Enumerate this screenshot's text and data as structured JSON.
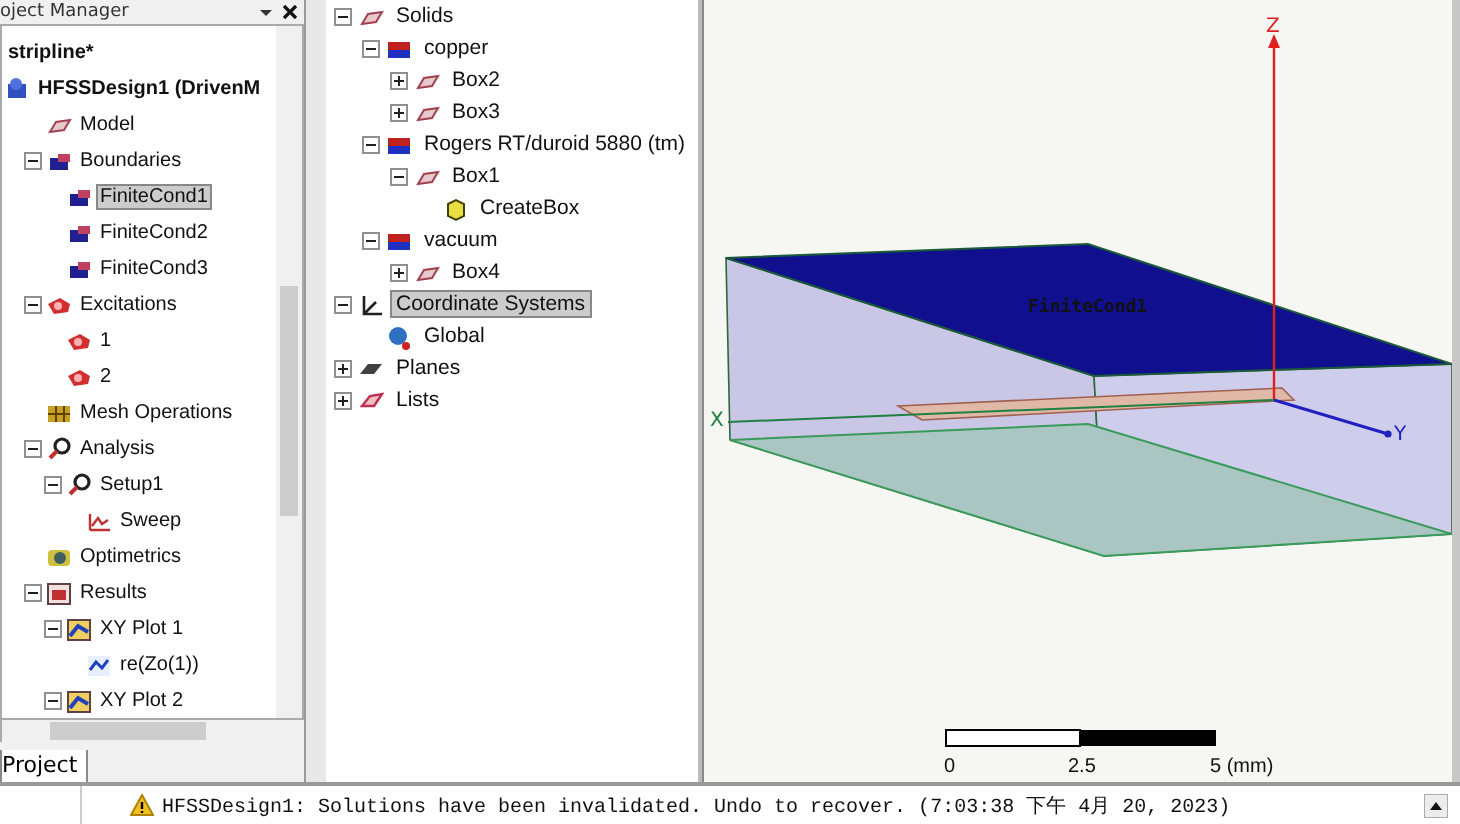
{
  "project_manager": {
    "title": "oject Manager",
    "tab": "Project",
    "tree": [
      {
        "label": "stripline*",
        "kind": "project",
        "selected": false
      },
      {
        "label": "HFSSDesign1 (DrivenM",
        "kind": "design",
        "selected": false,
        "children": [
          {
            "label": "Model",
            "kind": "part",
            "selected": false
          },
          {
            "label": "Boundaries",
            "kind": "boundary",
            "selected": false,
            "expanded": true,
            "children": [
              {
                "label": "FiniteCond1",
                "kind": "boundary",
                "selected": true
              },
              {
                "label": "FiniteCond2",
                "kind": "boundary",
                "selected": false
              },
              {
                "label": "FiniteCond3",
                "kind": "boundary",
                "selected": false
              }
            ]
          },
          {
            "label": "Excitations",
            "kind": "excitation",
            "selected": false,
            "expanded": true,
            "children": [
              {
                "label": "1",
                "kind": "excitation",
                "selected": false
              },
              {
                "label": "2",
                "kind": "excitation",
                "selected": false
              }
            ]
          },
          {
            "label": "Mesh Operations",
            "kind": "mesh",
            "selected": false
          },
          {
            "label": "Analysis",
            "kind": "analysis",
            "selected": false,
            "expanded": true,
            "children": [
              {
                "label": "Setup1",
                "kind": "analysis",
                "selected": false,
                "expanded": true,
                "children": [
                  {
                    "label": "Sweep",
                    "kind": "sweep",
                    "selected": false
                  }
                ]
              }
            ]
          },
          {
            "label": "Optimetrics",
            "kind": "optimetrics",
            "selected": false
          },
          {
            "label": "Results",
            "kind": "results",
            "selected": false,
            "expanded": true,
            "children": [
              {
                "label": "XY Plot 1",
                "kind": "plot",
                "selected": false,
                "expanded": true,
                "children": [
                  {
                    "label": "re(Zo(1))",
                    "kind": "trace",
                    "selected": false
                  }
                ]
              },
              {
                "label": "XY Plot 2",
                "kind": "plot",
                "selected": false,
                "expanded": true
              }
            ]
          }
        ]
      }
    ]
  },
  "model_tree": [
    {
      "label": "Solids",
      "kind": "part",
      "selected": false,
      "expanded": true,
      "children": [
        {
          "label": "copper",
          "kind": "material",
          "selected": false,
          "expanded": true,
          "children": [
            {
              "label": "Box2",
              "kind": "part",
              "selected": false,
              "expanded": false
            },
            {
              "label": "Box3",
              "kind": "part",
              "selected": false,
              "expanded": false
            }
          ]
        },
        {
          "label": "Rogers RT/duroid 5880 (tm)",
          "kind": "material",
          "selected": false,
          "expanded": true,
          "children": [
            {
              "label": "Box1",
              "kind": "part",
              "selected": false,
              "expanded": true,
              "children": [
                {
                  "label": "CreateBox",
                  "kind": "operation",
                  "selected": false
                }
              ]
            }
          ]
        },
        {
          "label": "vacuum",
          "kind": "material",
          "selected": false,
          "expanded": true,
          "children": [
            {
              "label": "Box4",
              "kind": "part",
              "selected": false,
              "expanded": false
            }
          ]
        }
      ]
    },
    {
      "label": "Coordinate Systems",
      "kind": "coords",
      "selected": true,
      "expanded": true,
      "children": [
        {
          "label": "Global",
          "kind": "origin",
          "selected": false
        }
      ]
    },
    {
      "label": "Planes",
      "kind": "planes",
      "selected": false,
      "expanded": false
    },
    {
      "label": "Lists",
      "kind": "lists",
      "selected": false,
      "expanded": false
    }
  ],
  "viewport": {
    "boundary_label": "FiniteCond1",
    "axis_labels": {
      "x": "X",
      "y": "Y",
      "z": "Z"
    },
    "scale_ticks": [
      "0",
      "2.5",
      "5 (mm)"
    ]
  },
  "message_bar": {
    "kind": "warning",
    "text": "HFSSDesign1: Solutions have been invalidated. Undo to recover. (7:03:38 下午  4月 20, 2023)"
  }
}
